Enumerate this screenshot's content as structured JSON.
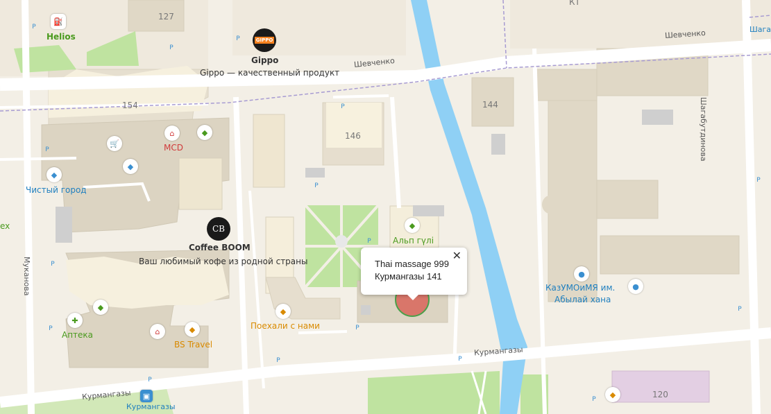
{
  "streets": {
    "shevchenko_1": "Шевченко",
    "shevchenko_2": "Шевченко",
    "shagabutdinova": "Шагабутдинова",
    "shagab_short": "Шагаб",
    "mukanova": "Муканова",
    "kurmangazy_1": "Курмангазы",
    "kurmangazy_2": "Курмангазы"
  },
  "buildings": {
    "b127": "127",
    "b154": "154",
    "b146": "146",
    "b144": "144",
    "b120": "120",
    "kt": "КТ"
  },
  "pois": {
    "helios": "Helios",
    "gippo": "Gippo",
    "gippo_logo": "GIPPO",
    "gippo_slogan": "Gippo — качественный продукт",
    "mcd": "MCD",
    "chisty_gorod": "Чистый город",
    "coffee_boom": "Coffee BOOM",
    "coffee_logo": "CB",
    "coffee_slogan": "Ваш любимый кофе из родной страны",
    "alp_guli": "Альп гүлі",
    "poekhali": "Поехали с нами",
    "apteka": "Аптека",
    "bs_travel": "BS Travel",
    "kazumoima": "КазУМОиМЯ им.",
    "ablai_khana": "Абылай хана",
    "ex": "ex",
    "bus_stop": "Курмангазы"
  },
  "popup": {
    "line1": "Thai massage 999",
    "line2": "Курмангазы 141",
    "close": "✕"
  },
  "colors": {
    "background": "#f3efe6",
    "canal": "#8fd0f5",
    "park": "#bfe3a0",
    "building": "#e3dccd",
    "building_light": "#f8f2df",
    "highlight_building": "#e3cfe3"
  }
}
